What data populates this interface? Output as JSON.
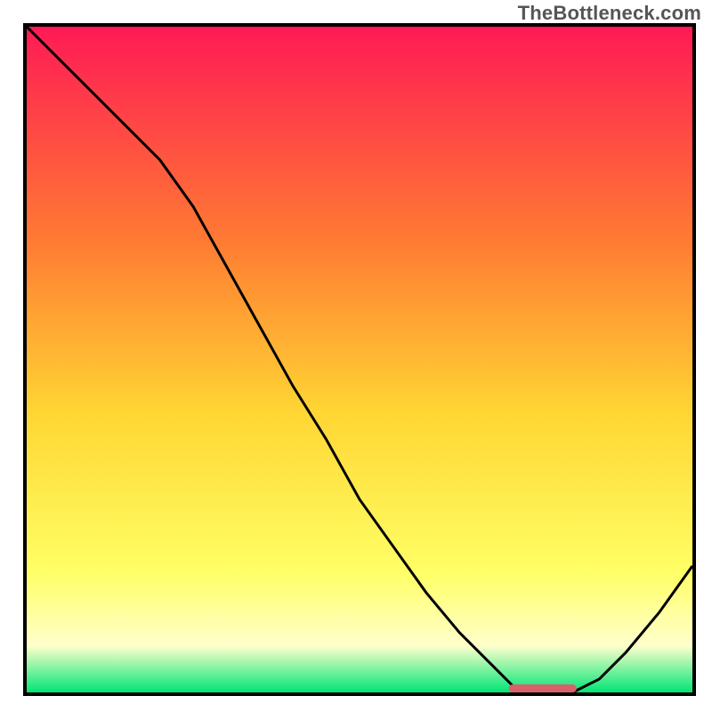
{
  "watermark": "TheBottleneck.com",
  "chart_data": {
    "type": "line",
    "title": "",
    "xlabel": "",
    "ylabel": "",
    "xlim": [
      0,
      100
    ],
    "ylim": [
      0,
      100
    ],
    "grid": false,
    "background_gradient": {
      "top_color": "#ff1a55",
      "mid_upper_color": "#ff7a33",
      "mid_color": "#ffd633",
      "mid_lower_color": "#ffff66",
      "lower_band_color": "#ffffcc",
      "bottom_color": "#00e676"
    },
    "series": [
      {
        "name": "bottleneck-curve",
        "x": [
          0,
          5,
          10,
          15,
          20,
          25,
          30,
          35,
          40,
          45,
          50,
          55,
          60,
          65,
          70,
          73,
          78,
          82,
          86,
          90,
          95,
          100
        ],
        "y": [
          100,
          95,
          90,
          85,
          80,
          73,
          64,
          55,
          46,
          38,
          29,
          22,
          15,
          9,
          4,
          1,
          0,
          0,
          2,
          6,
          12,
          19
        ],
        "stroke": "#000000",
        "stroke_width": 3
      },
      {
        "name": "optimal-band",
        "type": "segment",
        "x": [
          73,
          82
        ],
        "y": [
          0.6,
          0.6
        ],
        "stroke": "#d9606a",
        "stroke_width": 9,
        "linecap": "round"
      }
    ]
  }
}
